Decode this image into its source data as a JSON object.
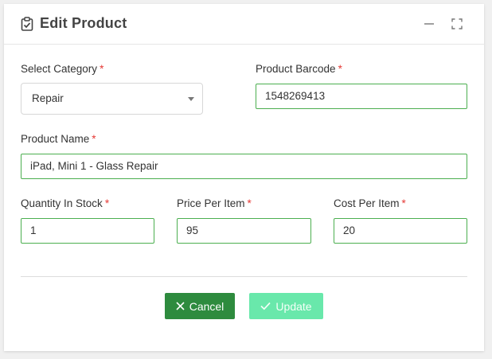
{
  "header": {
    "title": "Edit Product",
    "icons": [
      "clipboard-check-icon",
      "minimize-icon",
      "maximize-icon"
    ]
  },
  "form": {
    "category": {
      "label": "Select Category",
      "required": "*",
      "value": "Repair"
    },
    "barcode": {
      "label": "Product Barcode",
      "required": "*",
      "value": "1548269413"
    },
    "name": {
      "label": "Product Name",
      "required": "*",
      "value": "iPad, Mini 1 - Glass Repair"
    },
    "quantity": {
      "label": "Quantity In Stock",
      "required": "*",
      "value": "1"
    },
    "price": {
      "label": "Price Per Item",
      "required": "*",
      "value": "95"
    },
    "cost": {
      "label": "Cost Per Item",
      "required": "*",
      "value": "20"
    }
  },
  "actions": {
    "cancel_label": "Cancel",
    "update_label": "Update"
  },
  "colors": {
    "input_border": "#4caf50",
    "cancel_bg": "#2e8b3e",
    "update_bg": "#69e8ab",
    "required": "#e53935"
  }
}
